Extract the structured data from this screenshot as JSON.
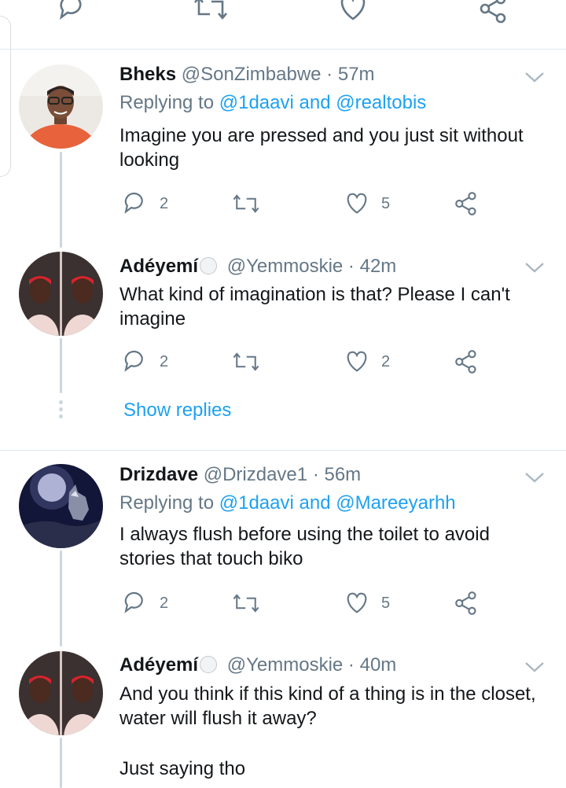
{
  "tweets": [
    {
      "name": "Bheks",
      "handle": "@SonZimbabwe",
      "separator": "·",
      "time": "57m",
      "replying_prefix": "Replying to",
      "replying_mentions": "@1daavi and @realtobis",
      "text": "Imagine you are pressed and you just sit without looking",
      "replies": "2",
      "retweets": "",
      "likes": "5"
    },
    {
      "name": "Adéyemí",
      "handle": "@Yemmoskie",
      "separator": "·",
      "time": "42m",
      "text": "What kind of imagination is that? Please I can't imagine",
      "replies": "2",
      "retweets": "",
      "likes": "2"
    },
    {
      "name": "Drizdave",
      "handle": "@Drizdave1",
      "separator": "·",
      "time": "56m",
      "replying_prefix": "Replying to",
      "replying_mentions": "@1daavi and @Mareeyarhh",
      "text": "I always flush before using the toilet to avoid stories that touch biko",
      "replies": "2",
      "retweets": "",
      "likes": "5"
    },
    {
      "name": "Adéyemí",
      "handle": "@Yemmoskie",
      "separator": "·",
      "time": "40m",
      "text": "And you think if this kind of a thing is in the closet, water will flush it away?",
      "text2": "Just saying tho"
    }
  ],
  "show_replies": "Show replies",
  "colors": {
    "accent": "#1da1f2",
    "muted": "#657786",
    "line": "#ccd6dd"
  },
  "icons": [
    "reply-icon",
    "retweet-icon",
    "like-icon",
    "share-icon",
    "chevron-down-icon"
  ]
}
